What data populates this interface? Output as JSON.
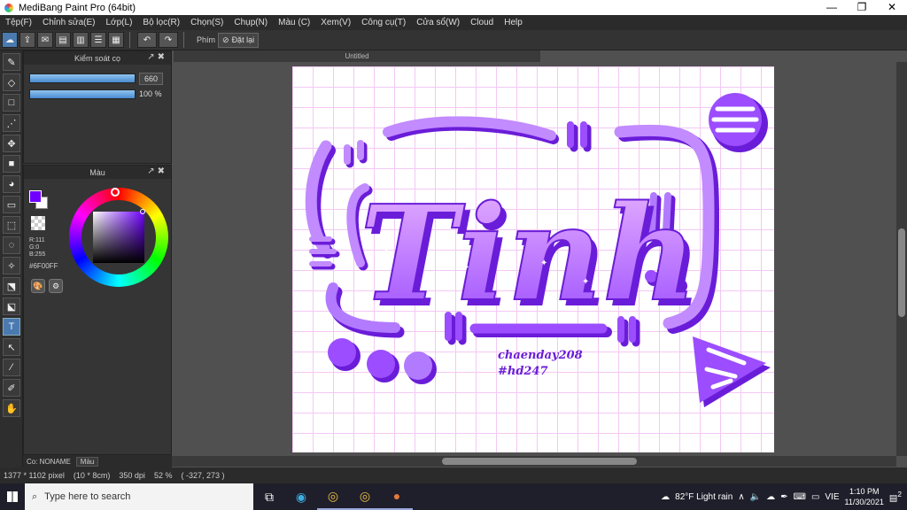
{
  "window": {
    "title": "MediBang Paint Pro (64bit)",
    "controls": [
      "—",
      "❐",
      "✕"
    ]
  },
  "menu": [
    "Tệp(F)",
    "Chỉnh sửa(E)",
    "Lớp(L)",
    "Bộ lọc(R)",
    "Chọn(S)",
    "Chụp(N)",
    "Màu (C)",
    "Xem(V)",
    "Công cụ(T)",
    "Cửa sổ(W)",
    "Cloud",
    "Help"
  ],
  "toolbar": {
    "shortcut_label": "Phím",
    "reset_label": "Đặt lại"
  },
  "brush_panel": {
    "title": "Kiểm soát cọ",
    "size_value": "660",
    "opacity_value": "100 %"
  },
  "color_panel": {
    "title": "Màu",
    "r": "R:111",
    "g": "G:0",
    "b": "B:255",
    "hex": "#6F00FF",
    "fg_color": "#6f00ff"
  },
  "layer_bar": {
    "label": "Co: NONAME",
    "tab": "Màu"
  },
  "document": {
    "tab_title": "Untitled"
  },
  "artwork": {
    "main_text": "Tinh",
    "signature": "chaenday208",
    "hashtag": "#hd247",
    "accent": "#9b4dff",
    "shadow": "#6a1dd8"
  },
  "status": {
    "size": "1377 * 1102 pixel",
    "physical": "(10 * 8cm)",
    "dpi": "350 dpi",
    "zoom": "52 %",
    "coords": "( -327, 273 )"
  },
  "taskbar": {
    "search_placeholder": "Type here to search",
    "weather": "82°F  Light rain",
    "lang": "VIE",
    "time": "1:10 PM",
    "date": "11/30/2021",
    "notifications": "2"
  }
}
